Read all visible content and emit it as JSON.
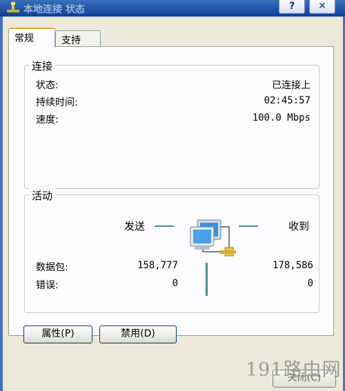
{
  "window": {
    "title": "本地连接 状态",
    "help_label": "?",
    "close_label": "✕"
  },
  "tabs": [
    {
      "label": "常规",
      "active": true
    },
    {
      "label": "支持",
      "active": false
    }
  ],
  "connection": {
    "group_title": "连接",
    "rows": [
      {
        "label": "状态:",
        "value": "已连接上"
      },
      {
        "label": "持续时间:",
        "value": "02:45:57"
      },
      {
        "label": "速度:",
        "value": "100.0 Mbps"
      }
    ]
  },
  "activity": {
    "group_title": "活动",
    "sent_label": "发送",
    "received_label": "收到",
    "packets_label": "数据包:",
    "errors_label": "错误:",
    "sent_packets": "158,777",
    "received_packets": "178,586",
    "sent_errors": "0",
    "received_errors": "0",
    "network_icon": "network-computers-icon"
  },
  "buttons": {
    "properties_label": "属性(P)",
    "disable_label": "禁用(D)",
    "close_label": "关闭(C)"
  },
  "watermark": "191路由网",
  "colors": {
    "titlebar": "#0b3f9a",
    "tab_highlight": "#e8a23a",
    "link_line": "#4d8a93"
  }
}
